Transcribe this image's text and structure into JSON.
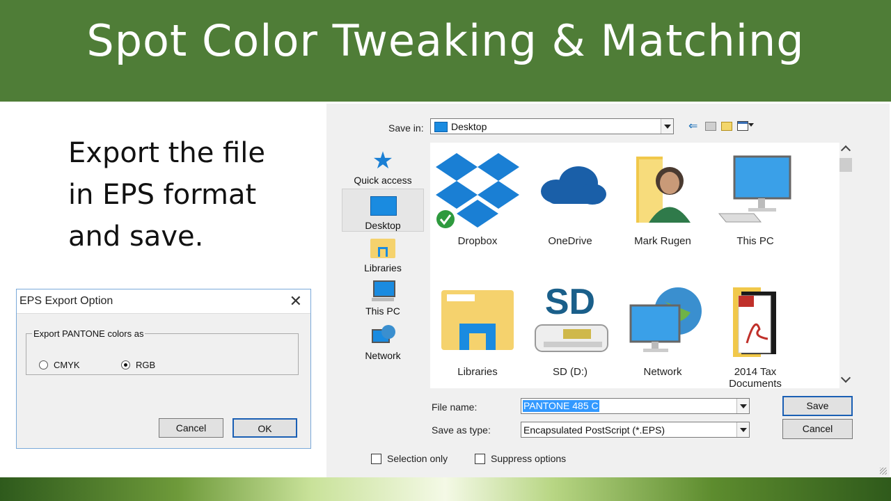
{
  "slide": {
    "title": "Spot Color Tweaking & Matching",
    "bullet_lines": [
      "Export the file",
      "in EPS format",
      "and save."
    ]
  },
  "eps_dialog": {
    "title": "EPS Export Option",
    "group_label": "Export PANTONE colors as",
    "options": [
      {
        "label": "CMYK",
        "selected": false
      },
      {
        "label": "RGB",
        "selected": true
      }
    ],
    "cancel_label": "Cancel",
    "ok_label": "OK"
  },
  "save_dialog": {
    "save_in_label": "Save in:",
    "save_in_value": "Desktop",
    "sidebar": [
      {
        "label": "Quick access",
        "icon": "star-icon"
      },
      {
        "label": "Desktop",
        "icon": "desktop-icon",
        "selected": true
      },
      {
        "label": "Libraries",
        "icon": "libraries-icon"
      },
      {
        "label": "This PC",
        "icon": "computer-icon"
      },
      {
        "label": "Network",
        "icon": "network-icon"
      }
    ],
    "files": [
      {
        "label": "Dropbox",
        "icon": "dropbox-icon"
      },
      {
        "label": "OneDrive",
        "icon": "onedrive-icon"
      },
      {
        "label": "Mark Rugen",
        "icon": "user-folder-icon"
      },
      {
        "label": "This PC",
        "icon": "computer-icon"
      },
      {
        "label": "Libraries",
        "icon": "libraries-folder-icon"
      },
      {
        "label": "SD (D:)",
        "icon": "sd-card-icon",
        "art_text": "SD"
      },
      {
        "label": "Network",
        "icon": "network-globe-icon"
      },
      {
        "label": "2014 Tax Documents",
        "icon": "pdf-folder-icon"
      }
    ],
    "file_name_label": "File name:",
    "file_name_value": "PANTONE 485 C",
    "save_type_label": "Save as type:",
    "save_type_value": "Encapsulated PostScript (*.EPS)",
    "save_button": "Save",
    "cancel_button": "Cancel",
    "checkboxes": [
      {
        "label": "Selection only",
        "checked": false
      },
      {
        "label": "Suppress options",
        "checked": false
      }
    ],
    "colors": {
      "selection": "#3399ff",
      "accent": "#1a7fd4"
    }
  }
}
